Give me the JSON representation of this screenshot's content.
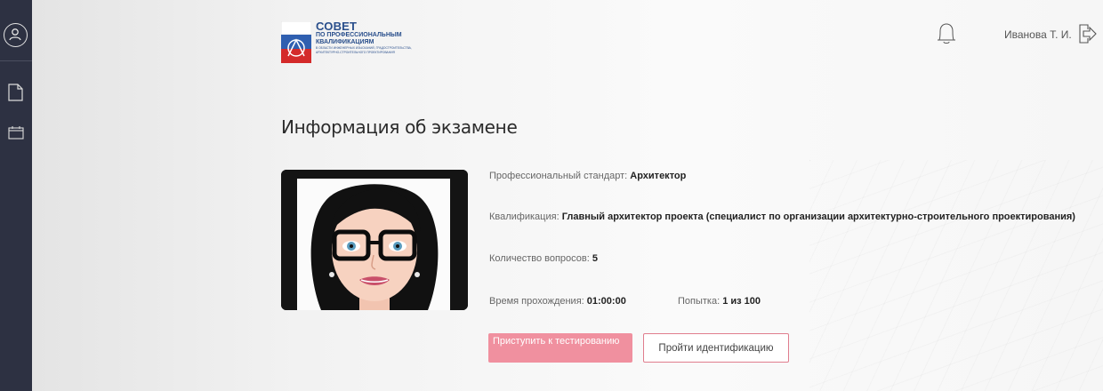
{
  "header": {
    "logo": {
      "line1": "СОВЕТ",
      "line2": "ПО ПРОФЕССИОНАЛЬНЫМ",
      "line3": "КВАЛИФИКАЦИЯМ",
      "line4": "В ОБЛАСТИ ИНЖЕНЕРНЫХ ИЗЫСКАНИЙ, ГРАДОСТРОИТЕЛЬСТВА,",
      "line5": "АРХИТЕКТУРНО-СТРОИТЕЛЬНОГО ПРОЕКТИРОВАНИЯ"
    },
    "user_name": "Иванова Т. И."
  },
  "page": {
    "title": "Информация об экзамене"
  },
  "exam": {
    "standard_label": "Профессиональный стандарт:",
    "standard_value": "Архитектор",
    "qualification_label": "Квалификация:",
    "qualification_value": "Главный архитектор проекта (специалист по организации архитектурно-строительного проектирования)",
    "questions_label": "Количество вопросов:",
    "questions_value": "5",
    "time_label": "Время прохождения:",
    "time_value": "01:00:00",
    "attempt_label": "Попытка:",
    "attempt_value": "1 из 100"
  },
  "actions": {
    "start_label": "Приступить к тестированию",
    "identify_label": "Пройти идентификацию"
  },
  "colors": {
    "sidebar": "#2d3142",
    "start_button": "#f0909f",
    "identify_border": "#e07d8d",
    "logo_blue": "#2a4f8c"
  },
  "icons": {
    "sidebar": [
      "user-circle-icon",
      "document-icon",
      "calendar-icon"
    ],
    "header": [
      "bell-icon",
      "logout-icon"
    ]
  }
}
